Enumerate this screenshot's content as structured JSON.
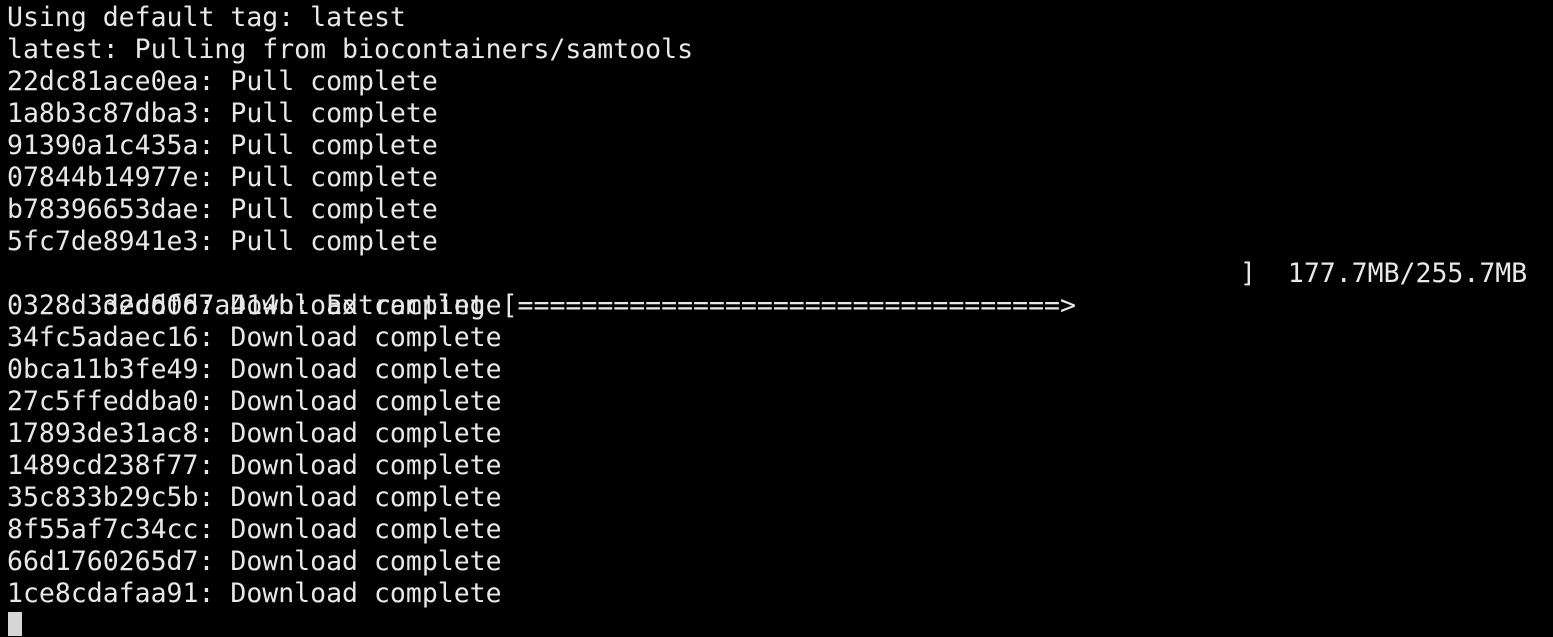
{
  "terminal": {
    "lines": [
      "Using default tag: latest",
      "latest: Pulling from biocontainers/samtools",
      "22dc81ace0ea: Pull complete",
      "1a8b3c87dba3: Pull complete",
      "91390a1c435a: Pull complete",
      "07844b14977e: Pull complete",
      "b78396653dae: Pull complete",
      "5fc7de8941e3: Pull complete",
      "0328d3decdfd: Download complete",
      "34fc5adaec16: Download complete",
      "0bca11b3fe49: Download complete",
      "27c5ffeddba0: Download complete",
      "17893de31ac8: Download complete",
      "1489cd238f77: Download complete",
      "35c833b29c5b: Download complete",
      "8f55af7c34cc: Download complete",
      "66d1760265d7: Download complete",
      "1ce8cdafaa91: Download complete"
    ],
    "extracting": {
      "layer_status": "32d6067a414b: Extracting [==================================>",
      "progress_tail": "]  177.7MB/255.7MB",
      "downloaded": "177.7MB",
      "total": "255.7MB",
      "progress": 0.695
    },
    "colors": {
      "background": "#000000",
      "foreground": "#e8e8e8",
      "cursor": "#d6d6d6"
    }
  }
}
